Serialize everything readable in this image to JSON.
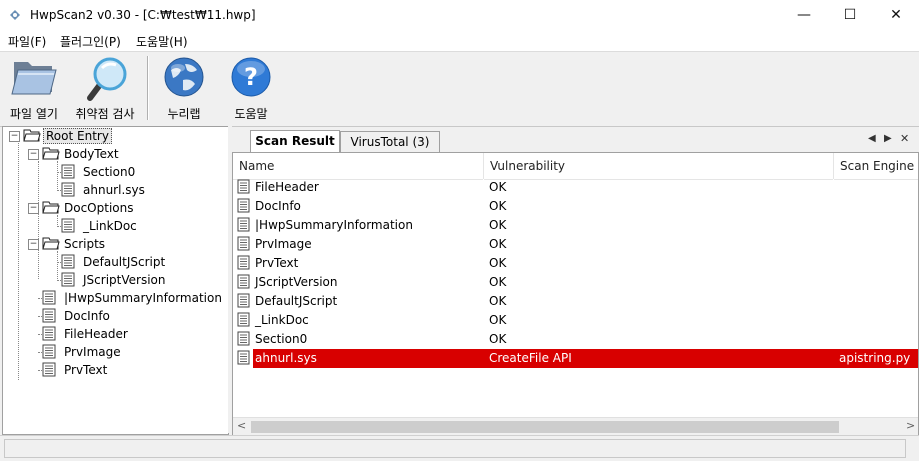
{
  "window": {
    "title": "HwpScan2 v0.30 - [C:₩test₩11.hwp]",
    "minimize_glyph": "—",
    "maximize_glyph": "☐",
    "close_glyph": "✕"
  },
  "menu": [
    {
      "label": "파일(F)"
    },
    {
      "label": "플러그인(P)"
    },
    {
      "label": "도움말(H)"
    }
  ],
  "toolbar": {
    "open_label": "파일 열기",
    "scan_label": "취약점 검사",
    "web_label": "누리랩",
    "help_label": "도움말",
    "icons": [
      "folder-open-icon",
      "magnifier-icon",
      "globe-icon",
      "help-icon"
    ]
  },
  "tree": {
    "root": "Root Entry",
    "bodytext": "BodyText",
    "section0": "Section0",
    "ahnurl": "ahnurl.sys",
    "docoptions": "DocOptions",
    "linkdoc": "_LinkDoc",
    "scripts": "Scripts",
    "defaultjscript": "DefaultJScript",
    "jscriptversion": "JScriptVersion",
    "summary": "|HwpSummaryInformation",
    "docinfo": "DocInfo",
    "fileheader": "FileHeader",
    "prvimage": "PrvImage",
    "prvtext": "PrvText",
    "expanded_glyph": "−"
  },
  "tabs": [
    {
      "label": "Scan Result"
    },
    {
      "label": "VirusTotal (3)"
    }
  ],
  "tab_controls": {
    "prev": "◀",
    "next": "▶",
    "close": "✕"
  },
  "table": {
    "columns": [
      "Name",
      "Vulnerability",
      "Scan Engine"
    ],
    "rows": [
      {
        "name": "FileHeader",
        "vuln": "OK",
        "engine": ""
      },
      {
        "name": "DocInfo",
        "vuln": "OK",
        "engine": ""
      },
      {
        "name": "|HwpSummaryInformation",
        "vuln": "OK",
        "engine": ""
      },
      {
        "name": "PrvImage",
        "vuln": "OK",
        "engine": ""
      },
      {
        "name": "PrvText",
        "vuln": "OK",
        "engine": ""
      },
      {
        "name": "JScriptVersion",
        "vuln": "OK",
        "engine": ""
      },
      {
        "name": "DefaultJScript",
        "vuln": "OK",
        "engine": ""
      },
      {
        "name": "_LinkDoc",
        "vuln": "OK",
        "engine": ""
      },
      {
        "name": "Section0",
        "vuln": "OK",
        "engine": ""
      },
      {
        "name": "ahnurl.sys",
        "vuln": "CreateFile API",
        "engine": "apistring.py"
      }
    ],
    "alert_color": "#d80000"
  },
  "scroll": {
    "left": "<",
    "right": ">"
  }
}
